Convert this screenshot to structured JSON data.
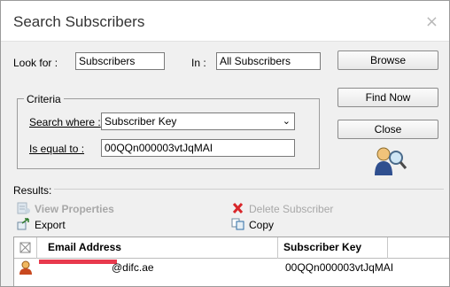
{
  "window": {
    "title": "Search Subscribers",
    "close_symbol": "×"
  },
  "search": {
    "look_for_label": "Look for :",
    "look_for_value": "Subscribers",
    "in_label": "In :",
    "in_value": "All Subscribers",
    "browse_label": "Browse"
  },
  "criteria": {
    "group_label": "Criteria",
    "search_where_label": "Search where :",
    "search_where_value": "Subscriber Key",
    "equal_label": "Is equal to :",
    "equal_value": "00QQn000003vtJqMAI"
  },
  "buttons": {
    "find_now": "Find Now",
    "close": "Close"
  },
  "results": {
    "label": "Results:",
    "actions": {
      "view_properties": "View Properties",
      "delete_subscriber": "Delete Subscriber",
      "export": "Export",
      "copy": "Copy"
    },
    "columns": [
      "Email Address",
      "Subscriber Key"
    ],
    "rows": [
      {
        "email": "@difc.ae",
        "subscriber_key": "00QQn000003vtJqMAI"
      }
    ]
  },
  "icons": {
    "title_close": "close-icon",
    "search_person": "search-person-icon",
    "view_properties": "properties-icon",
    "delete": "delete-x-icon",
    "export": "export-icon",
    "copy": "copy-icon",
    "row": "person-icon",
    "header_corner": "grid-corner-icon"
  }
}
